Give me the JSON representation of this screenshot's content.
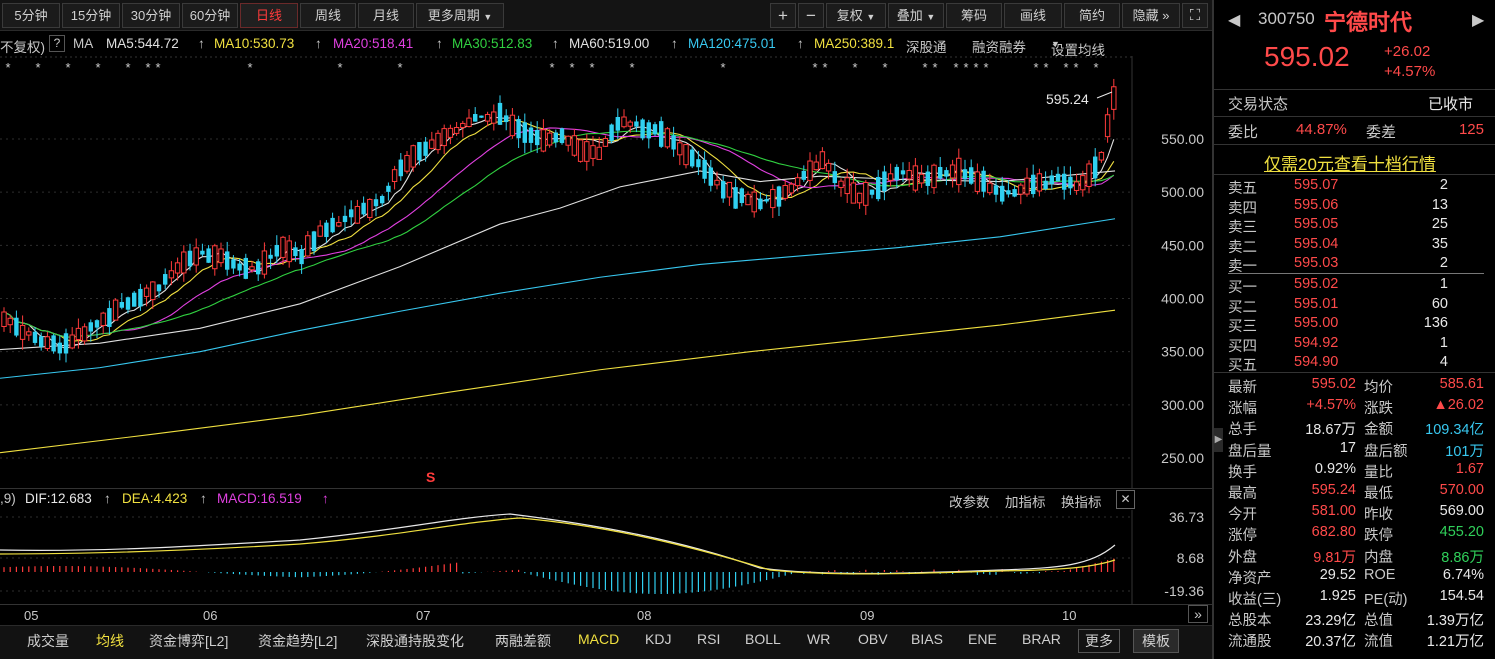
{
  "toolbar": {
    "periods": [
      "5分钟",
      "15分钟",
      "30分钟",
      "60分钟",
      "日线",
      "周线",
      "月线"
    ],
    "active_period": "日线",
    "more_period": "更多周期",
    "plus": "+",
    "minus": "−",
    "fuquan": "复权",
    "overlay": "叠加",
    "chouma": "筹码",
    "draw": "画线",
    "simple": "简约",
    "hide": "隐藏",
    "hide_arrow": "»",
    "expand_icon": "⛶"
  },
  "ma_bar": {
    "fq_label": "不复权)",
    "help": "?",
    "ma": "MA",
    "ma5": "MA5:544.72",
    "ma10": "MA10:530.73",
    "ma20": "MA20:518.41",
    "ma30": "MA30:512.83",
    "ma60": "MA60:519.00",
    "ma120": "MA120:475.01",
    "ma250": "MA250:389.1",
    "shenkutong": "深股通",
    "rongzi": "融资融券",
    "settings": "设置均线",
    "arrow_up": "↑",
    "colors": {
      "ma5": "#e0e0e0",
      "ma10": "#f0e040",
      "ma20": "#e040e0",
      "ma30": "#30d040",
      "ma60": "#e0e0e0",
      "ma120": "#38c8f0",
      "ma250": "#f0e040"
    }
  },
  "main_chart": {
    "price_ticks": [
      "550.00",
      "500.00",
      "450.00",
      "400.00",
      "350.00",
      "300.00",
      "250.00"
    ],
    "high_label": "595.24",
    "s_marker": "S"
  },
  "macd_bar": {
    "prefix": ",9)",
    "dif": "DIF:12.683",
    "dea": "DEA:4.423",
    "macd": "MACD:16.519",
    "change_params": "改参数",
    "add_indicator": "加指标",
    "switch_indicator": "换指标",
    "close": "✕",
    "ticks": [
      "36.73",
      "8.68",
      "-19.36"
    ]
  },
  "xaxis": {
    "months": [
      "05",
      "06",
      "07",
      "08",
      "09",
      "10"
    ],
    "more_icon": "»"
  },
  "indicators": {
    "items": [
      "成交量",
      "均线",
      "资金博弈[L2]",
      "资金趋势[L2]",
      "深股通持股变化",
      "两融差额",
      "MACD",
      "KDJ",
      "RSI",
      "BOLL",
      "WR",
      "OBV",
      "BIAS",
      "ENE",
      "BRAR"
    ],
    "active": "均线",
    "more": "更多",
    "template": "模板"
  },
  "quote": {
    "code": "300750",
    "name": "宁德时代",
    "price": "595.02",
    "change": "+26.02",
    "change_pct": "+4.57%",
    "status_label": "交易状态",
    "status_value": "已收市",
    "weibi_label": "委比",
    "weibi_value": "44.87%",
    "weicha_label": "委差",
    "weicha_value": "125",
    "promo": "仅需20元查看十档行情",
    "asks": [
      {
        "label": "卖五",
        "price": "595.07",
        "vol": "2"
      },
      {
        "label": "卖四",
        "price": "595.06",
        "vol": "13"
      },
      {
        "label": "卖三",
        "price": "595.05",
        "vol": "25"
      },
      {
        "label": "卖二",
        "price": "595.04",
        "vol": "35"
      },
      {
        "label": "卖一",
        "price": "595.03",
        "vol": "2"
      }
    ],
    "bids": [
      {
        "label": "买一",
        "price": "595.02",
        "vol": "1"
      },
      {
        "label": "买二",
        "price": "595.01",
        "vol": "60"
      },
      {
        "label": "买三",
        "price": "595.00",
        "vol": "136"
      },
      {
        "label": "买四",
        "price": "594.92",
        "vol": "1"
      },
      {
        "label": "买五",
        "price": "594.90",
        "vol": "4"
      }
    ],
    "stats": [
      {
        "l1": "最新",
        "v1": "595.02",
        "c1": "red",
        "l2": "均价",
        "v2": "585.61",
        "c2": "red"
      },
      {
        "l1": "涨幅",
        "v1": "+4.57%",
        "c1": "red",
        "l2": "涨跌",
        "v2": "▲26.02",
        "c2": "red"
      },
      {
        "l1": "总手",
        "v1": "18.67万",
        "c1": "white",
        "l2": "金额",
        "v2": "109.34亿",
        "c2": "cyan"
      },
      {
        "l1": "盘后量",
        "v1": "17",
        "c1": "white",
        "l2": "盘后额",
        "v2": "101万",
        "c2": "cyan"
      },
      {
        "l1": "换手",
        "v1": "0.92%",
        "c1": "white",
        "l2": "量比",
        "v2": "1.67",
        "c2": "red"
      },
      {
        "l1": "最高",
        "v1": "595.24",
        "c1": "red",
        "l2": "最低",
        "v2": "570.00",
        "c2": "red"
      },
      {
        "l1": "今开",
        "v1": "581.00",
        "c1": "red",
        "l2": "昨收",
        "v2": "569.00",
        "c2": "white"
      },
      {
        "l1": "涨停",
        "v1": "682.80",
        "c1": "red",
        "l2": "跌停",
        "v2": "455.20",
        "c2": "green"
      },
      {
        "l1": "外盘",
        "v1": "9.81万",
        "c1": "red",
        "l2": "内盘",
        "v2": "8.86万",
        "c2": "green"
      },
      {
        "l1": "净资产",
        "v1": "29.52",
        "c1": "white",
        "l2": "ROE",
        "v2": "6.74%",
        "c2": "white"
      },
      {
        "l1": "收益(三)",
        "v1": "1.925",
        "c1": "white",
        "l2": "PE(动)",
        "v2": "154.54",
        "c2": "white"
      },
      {
        "l1": "总股本",
        "v1": "23.29亿",
        "c1": "white",
        "l2": "总值",
        "v2": "1.39万亿",
        "c2": "white"
      },
      {
        "l1": "流通股",
        "v1": "20.37亿",
        "c1": "white",
        "l2": "流值",
        "v2": "1.21万亿",
        "c2": "white"
      }
    ],
    "prev_icon": "◀",
    "next_icon": "▶",
    "collapse_icon": "▶"
  }
}
